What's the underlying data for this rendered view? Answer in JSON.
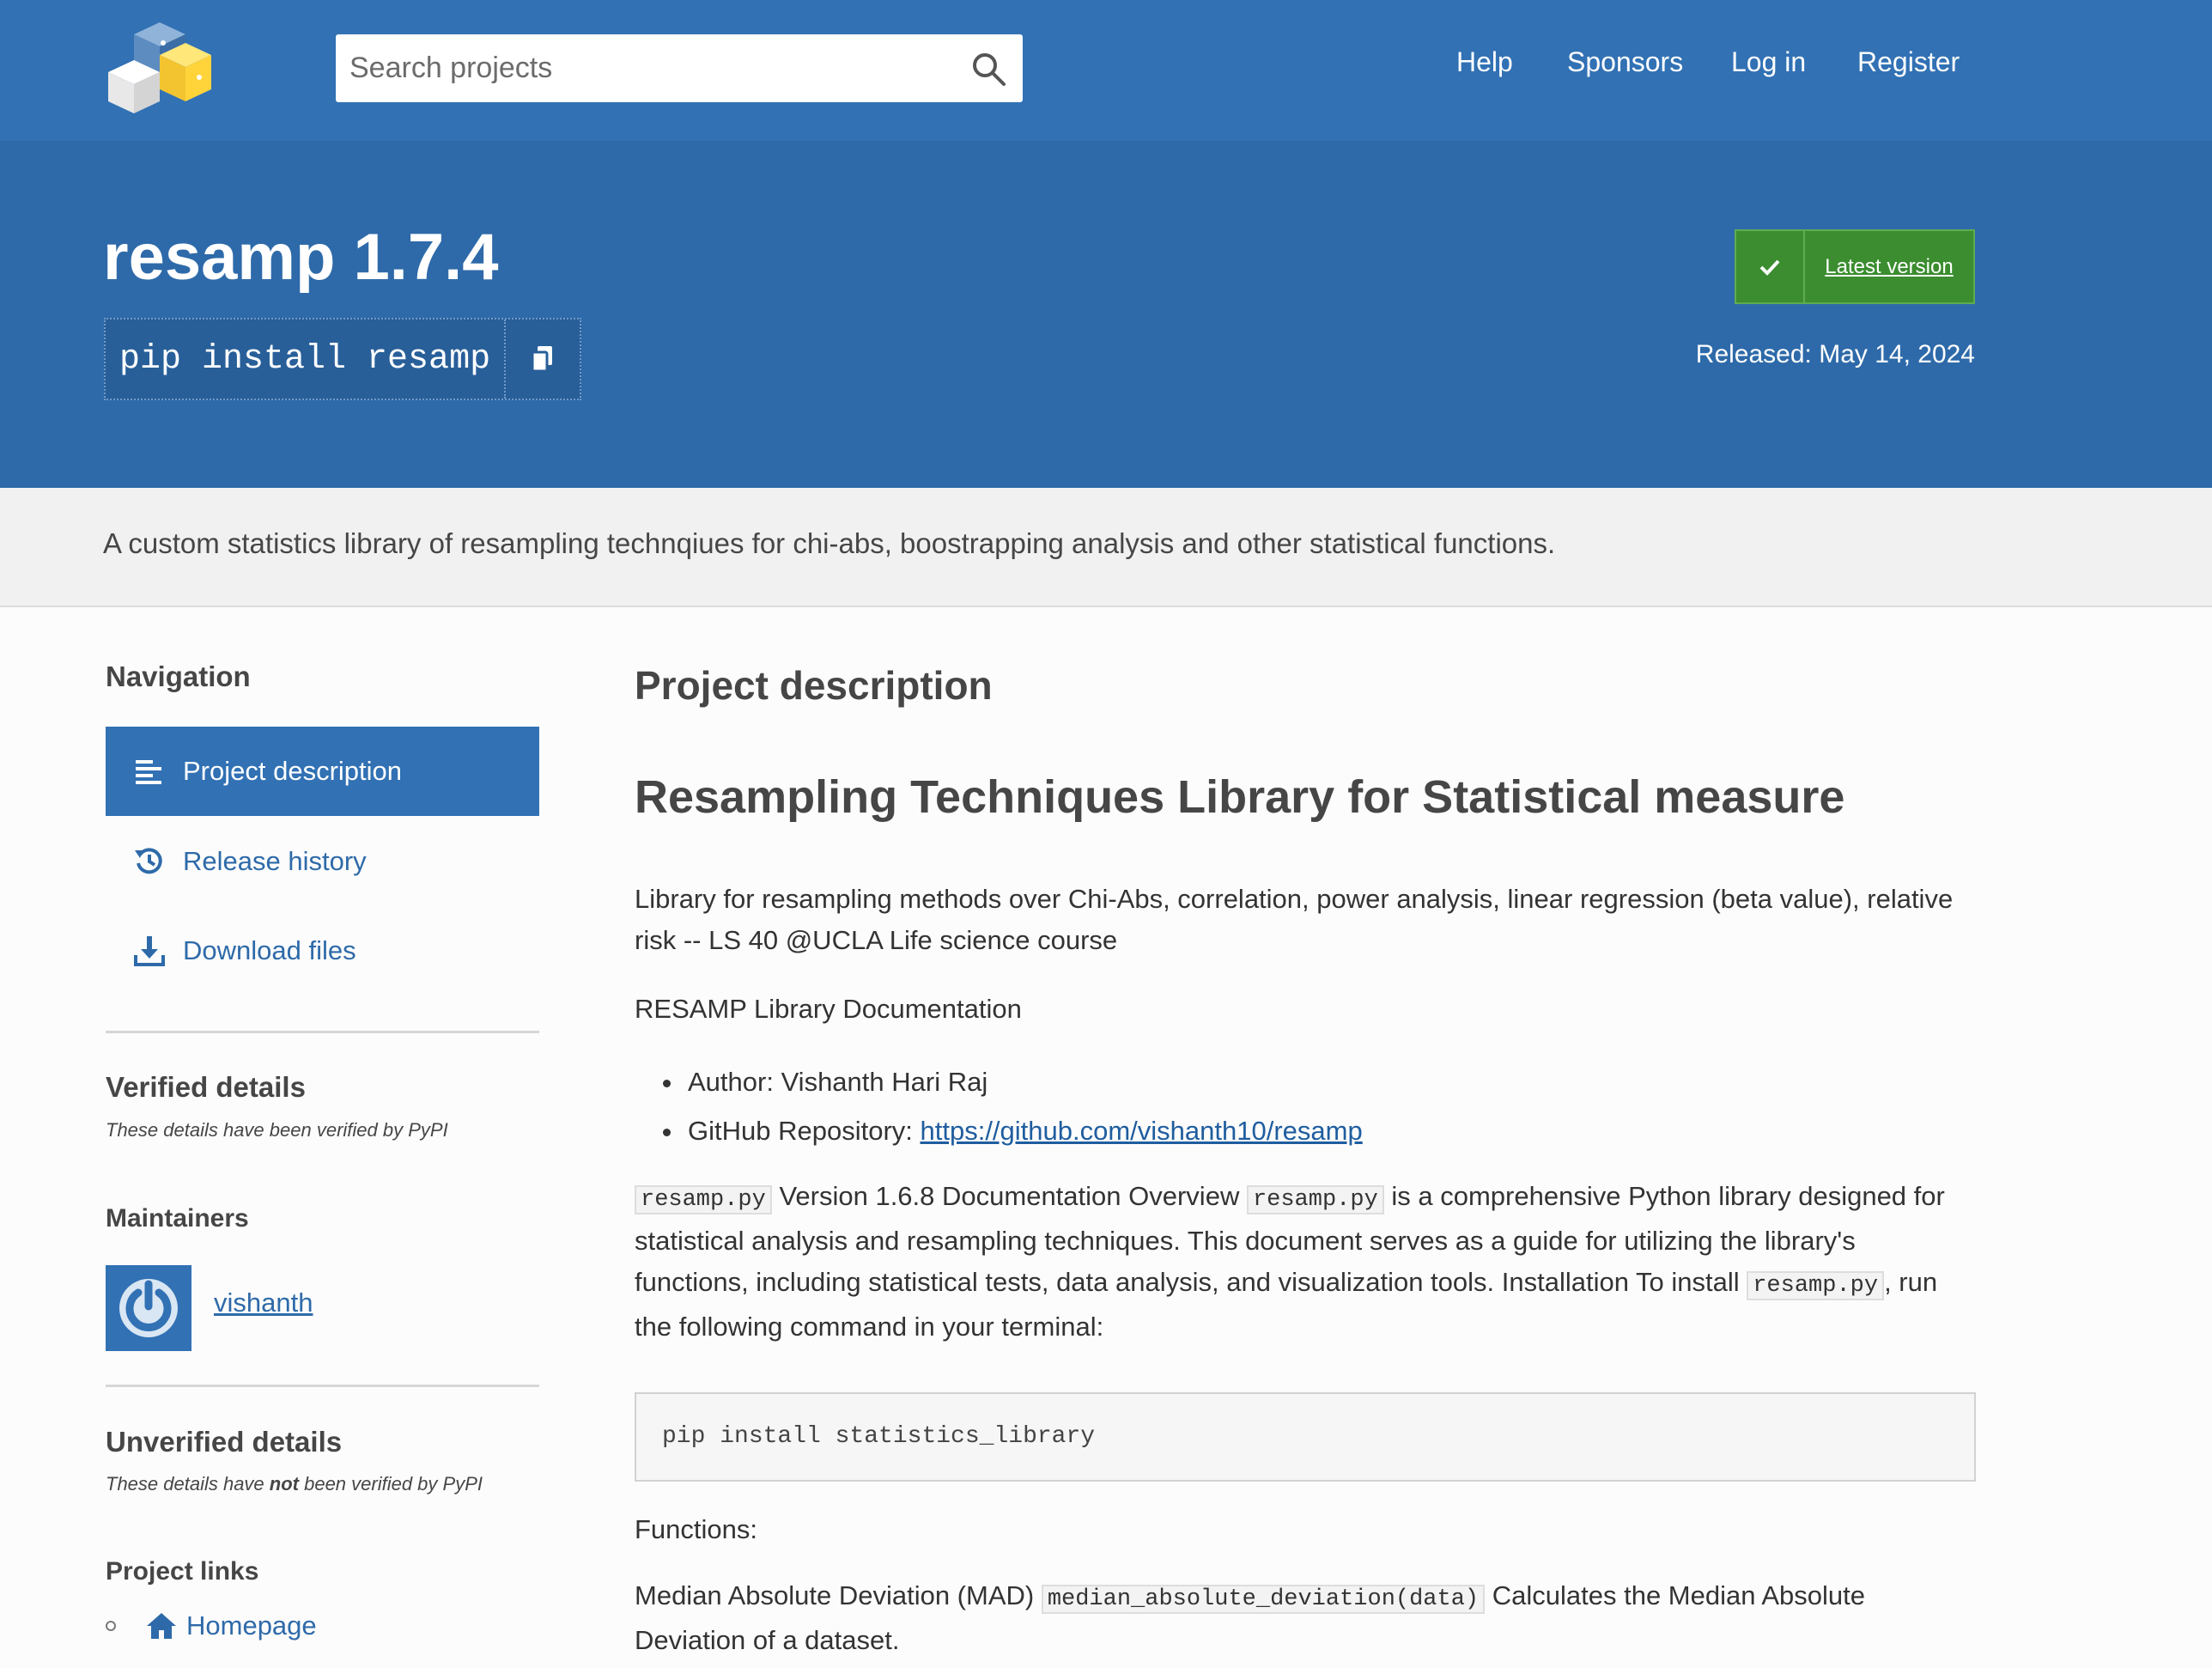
{
  "header": {
    "search_placeholder": "Search projects",
    "nav": [
      "Help",
      "Sponsors",
      "Log in",
      "Register"
    ]
  },
  "package": {
    "title": "resamp 1.7.4",
    "pip_command": "pip install resamp",
    "latest_label": "Latest version",
    "released": "Released: May 14, 2024"
  },
  "summary": "A custom statistics library of resampling technqiues for chi-abs, boostrapping analysis and other statistical functions.",
  "sidebar": {
    "nav_heading": "Navigation",
    "tabs": [
      "Project description",
      "Release history",
      "Download files"
    ],
    "verified_heading": "Verified details",
    "verified_note": "These details have been verified by PyPI",
    "maintainers_heading": "Maintainers",
    "maintainer": "vishanth",
    "unverified_heading": "Unverified details",
    "unverified_note_pre": "These details have ",
    "unverified_note_em": "not",
    "unverified_note_post": " been verified by PyPI",
    "project_links_heading": "Project links",
    "homepage": "Homepage"
  },
  "main": {
    "section_title": "Project description",
    "heading": "Resampling Techniques Library for Statistical measure",
    "intro": "Library for resampling methods over Chi-Abs, correlation, power analysis, linear regression (beta value), relative risk -- LS 40 @UCLA Life science course",
    "doc_title": "RESAMP Library Documentation",
    "author_prefix": "Author: ",
    "author": "Vishanth Hari Raj",
    "github_prefix": "GitHub Repository: ",
    "github_url": "https://github.com/vishanth10/resamp",
    "code_file": "resamp.py",
    "overview_1": " Version 1.6.8 Documentation Overview ",
    "overview_2": " is a comprehensive Python library designed for statistical analysis and resampling techniques. This document serves as a guide for utilizing the library's functions, including statistical tests, data analysis, and visualization tools. Installation To install ",
    "overview_3": ", run the following command in your terminal:",
    "install_cmd": "pip install statistics_library",
    "functions_label": "Functions:",
    "mad_prefix": "Median Absolute Deviation (MAD) ",
    "mad_code": "median_absolute_deviation(data)",
    "mad_suffix": " Calculates the Median Absolute Deviation of a dataset."
  },
  "colors": {
    "header_blue": "#3171b4",
    "hero_blue": "#2e6aa9",
    "latest_green": "#3b8d2f",
    "link_blue": "#2e6aa9"
  }
}
